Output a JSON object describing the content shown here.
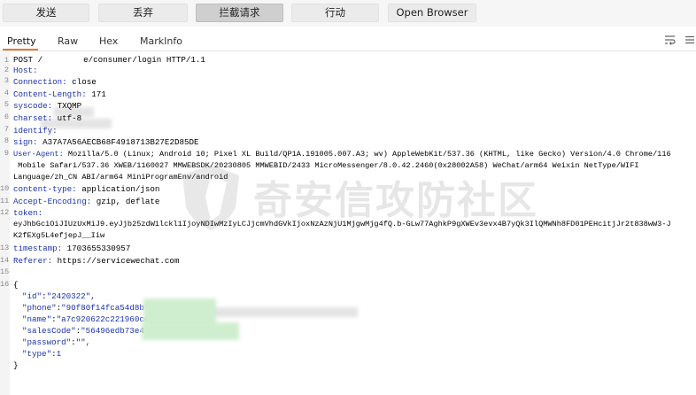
{
  "toolbar": {
    "buttons": [
      "发送",
      "丢弃",
      "拦截请求",
      "行动",
      "Open Browser"
    ]
  },
  "tabs": [
    "Pretty",
    "Raw",
    "Hex",
    "MarkInfo"
  ],
  "request": {
    "line_numbers": [
      "1",
      "2",
      "3",
      "4",
      "5",
      "6",
      "7",
      "8",
      "9",
      "",
      "",
      "10",
      "11",
      "12",
      "",
      "",
      "13",
      "14",
      "15",
      "16",
      "",
      "",
      "",
      "",
      "",
      "",
      "",
      ""
    ],
    "request_line": {
      "method": "POST /",
      "path_tail": "e/consumer/login HTTP/1.1"
    },
    "headers": [
      {
        "key": "Host:",
        "value": ""
      },
      {
        "key": "Connection:",
        "value": "close"
      },
      {
        "key": "Content-Length:",
        "value": "171"
      },
      {
        "key": "syscode:",
        "value": "TXQMP"
      },
      {
        "key": "charset:",
        "value": "utf-8"
      },
      {
        "key": "identify:",
        "value": ""
      },
      {
        "key": "sign:",
        "value": "A37A7A56AECB68F4918713B27E2D85DE"
      },
      {
        "key": "User-Agent:",
        "value": "Mozilla/5.0 (Linux; Android 10; Pixel XL Build/QP1A.191005.007.A3; wv) AppleWebKit/537.36 (KHTML, like Gecko) Version/4.0 Chrome/116"
      },
      {
        "key": "",
        "value": " Mobile Safari/537.36 XWEB/1160027 MMWEBSDK/20230805 MMWEBID/2433 MicroMessenger/8.0.42.2460(0x28002A58) WeChat/arm64 Weixin NetType/WIFI"
      },
      {
        "key": "",
        "value": "Language/zh_CN ABI/arm64 MiniProgramEnv/android"
      },
      {
        "key": "content-type:",
        "value": "application/json"
      },
      {
        "key": "Accept-Encoding:",
        "value": "gzip, deflate"
      },
      {
        "key": "token:",
        "value": ""
      },
      {
        "key": "",
        "value": "eyJhbGciOiJIUzUxMiJ9.eyJjb25zdW1lckl1IjoyNDIwMzIyLCJjcmVhdGVkIjoxNzAzNjU1MjgwMjg4fQ.b-GLw77AghkP9gXWEv3evx4B7yQk3IlQMWNh8FD01PEHcitjJr2t838wW3-J"
      },
      {
        "key": "",
        "value": "K2fEXg5L4efjepJ__Iiw"
      },
      {
        "key": "timestamp:",
        "value": "1703655330957"
      },
      {
        "key": "Referer:",
        "value": "https://servicewechat.com"
      }
    ],
    "body": {
      "open": "{",
      "fields": [
        {
          "key": "\"id\"",
          "value": "\"2420322\","
        },
        {
          "key": "\"phone\"",
          "value": "\"90f80f14fca54d8b75"
        },
        {
          "key": "\"name\"",
          "value": "\"a7c920622c221960cc"
        },
        {
          "key": "\"salesCode\"",
          "value": "\"56496edb73e4"
        },
        {
          "key": "\"password\"",
          "value": "\"\","
        },
        {
          "key": "\"type\"",
          "value": "1"
        }
      ],
      "close": "}"
    }
  },
  "watermark": {
    "text": "奇安信攻防社区"
  },
  "icons": {
    "wrap": "wrap-lines-icon",
    "menu": "menu-icon"
  },
  "colors": {
    "accent": "#e8772e",
    "header_key": "#1a32a8"
  }
}
